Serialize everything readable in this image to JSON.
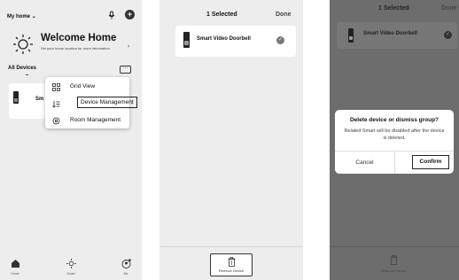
{
  "screen1": {
    "home_selector": "My home",
    "home_selector_icon": "chevron-down-icon",
    "welcome_title": "Welcome Home",
    "welcome_subtitle": "Set your home location for more information",
    "section_title": "All Devices",
    "device_name_truncated": "Sm",
    "menu": [
      {
        "icon": "grid-icon",
        "label": "Grid View"
      },
      {
        "icon": "sort-icon",
        "label": "Device Management"
      },
      {
        "icon": "gear-icon",
        "label": "Room Management"
      }
    ],
    "nav": [
      {
        "icon": "home-icon",
        "label": "Home"
      },
      {
        "icon": "sun-icon",
        "label": "Smart"
      },
      {
        "icon": "profile-icon",
        "label": "Me"
      }
    ]
  },
  "screen2": {
    "title": "1 Selected",
    "done": "Done",
    "device_name": "Smart Video Doorbell",
    "remove_label": "Remove Device"
  },
  "screen3": {
    "title": "1 Selected",
    "done": "Done",
    "device_name": "Smart Video Doorbell",
    "dialog_title": "Delete device or dismiss group?",
    "dialog_message": "Related Smart will be disabled after the device is deleted.",
    "cancel": "Cancel",
    "confirm": "Confirm",
    "remove_label": "Remove Device"
  }
}
